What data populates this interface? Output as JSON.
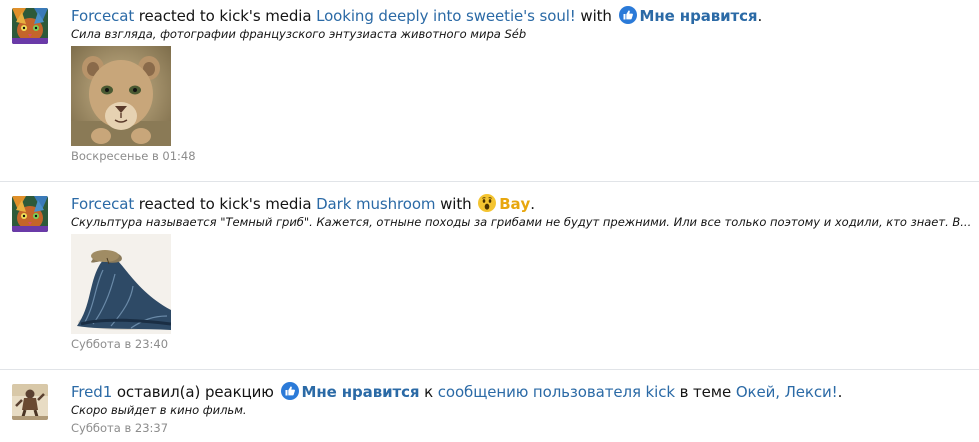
{
  "feed": {
    "items": [
      {
        "user": "Forcecat",
        "verb": "reacted to kick's media",
        "target": "Looking deeply into sweetie's soul!",
        "connector": "with",
        "reaction": "Мне нравится",
        "reaction_icon": "like-icon",
        "tail": ".",
        "snippet": "Сила взгляда, фотографии французского энтузиаста животного мира Séb",
        "thumbnail": "lion-cub-photo",
        "time": "Воскресенье в 01:48"
      },
      {
        "user": "Forcecat",
        "verb": "reacted to kick's media",
        "target": "Dark mushroom",
        "connector": "with",
        "reaction": "Вау",
        "reaction_icon": "wow-icon",
        "tail": ".",
        "snippet": "Скульптура называется \"Темный гриб\". Кажется, отныне походы за грибами не будут прежними. Или все только поэтому и ходили, кто знает. В...",
        "thumbnail": "dark-mushroom-sculpture-photo",
        "time": "Суббота в 23:40"
      },
      {
        "user": "Fred1",
        "verb": "оставил(а) реакцию",
        "reaction": "Мне нравится",
        "reaction_icon": "like-icon",
        "connector": "к",
        "target": "сообщению пользователя kick",
        "location_prefix": "в теме",
        "location": "Окей, Лекси!",
        "tail": ".",
        "snippet": "Скоро выйдет в кино фильм.",
        "time": "Суббота в 23:37"
      }
    ]
  },
  "colors": {
    "link": "#2b6aa6",
    "like": "#2b6aa6",
    "wow": "#e8a70e",
    "muted": "#8c8c8c",
    "divider": "#e1e4e8"
  }
}
